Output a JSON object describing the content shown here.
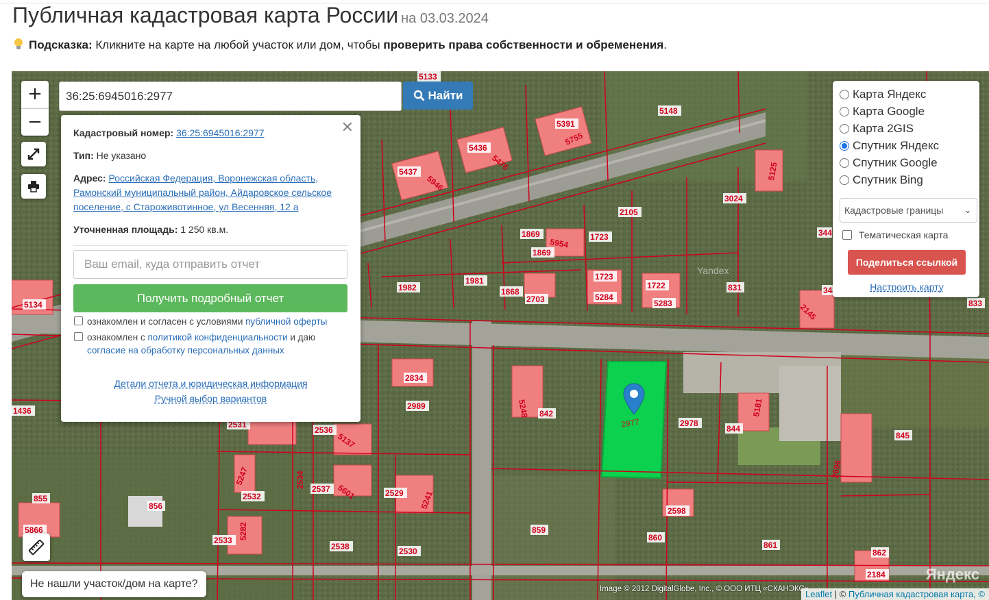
{
  "header": {
    "title": "Публичная кадастровая карта России",
    "date_suffix": "на 03.03.2024",
    "hint_label": "Подсказка:",
    "hint_text": " Кликните на карте на любой участок или дом, чтобы ",
    "hint_bold": "проверить права собственности и обременения",
    "hint_end": "."
  },
  "search": {
    "value": "36:25:6945016:2977",
    "button_label": "Найти"
  },
  "controls": {
    "zoom_in": "+",
    "zoom_out": "−"
  },
  "popup": {
    "cadastral_label": "Кадастровый номер:",
    "cadastral_value": "36:25:6945016:2977",
    "type_label": "Тип:",
    "type_value": "Не указано",
    "address_label": "Адрес:",
    "address_value": "Российская Федерация, Воронежская область, Рамонский муниципальный район, Айдаровское сельское поселение, с Староживотинное, ул Весенняя, 12 а",
    "area_label": "Уточненная площадь:",
    "area_value": "1 250 кв.м.",
    "email_placeholder": "Ваш email, куда отправить отчет",
    "report_button": "Получить подробный отчет",
    "agree1_text": "ознакомлен и согласен с условиями ",
    "agree1_link": "публичной оферты",
    "agree2_text": "ознакомлен с ",
    "agree2_link": "политикой конфиденциальности",
    "agree2_mid": " и даю ",
    "agree2_link2": "согласие на обработку персональных данных",
    "details_link": "Детали отчета и юридическая информация",
    "manual_link": "Ручной выбор вариантов"
  },
  "layers": {
    "options": [
      {
        "label": "Карта Яндекс",
        "checked": false
      },
      {
        "label": "Карта Google",
        "checked": false
      },
      {
        "label": "Карта 2GIS",
        "checked": false
      },
      {
        "label": "Спутник Яндекс",
        "checked": true
      },
      {
        "label": "Спутник Google",
        "checked": false
      },
      {
        "label": "Спутник Bing",
        "checked": false
      }
    ],
    "select_value": "Кадастровые границы",
    "thematic_label": "Тематическая карта",
    "share_button": "Поделиться ссылкой",
    "configure_link": "Настроить карту"
  },
  "map": {
    "not_found_button": "Не нашли участок/дом на карте?",
    "attribution_leaflet": "Leaflet",
    "attribution_sep": " | © ",
    "attribution_text": "Публичная кадастровая карта, ©",
    "imagery_credit": "Image © 2012 DigitalGlobe, Inc., © ООО ИТЦ «СКАНЭКС»",
    "watermark": "Яндекс",
    "selected_plot_label": "2977",
    "plot_labels": [
      "5133",
      "5148",
      "5391",
      "5755",
      "5436",
      "5476",
      "5437",
      "5946",
      "5125",
      "3024",
      "2105",
      "1869",
      "5954",
      "1723",
      "1869",
      "344",
      "1982",
      "1981",
      "1868",
      "2703",
      "1723",
      "5284",
      "1722",
      "5283",
      "831",
      "344",
      "2145",
      "833",
      "5134",
      "2834",
      "2989",
      "5248",
      "842",
      "2978",
      "844",
      "5181",
      "1436",
      "2531",
      "2536",
      "5137",
      "5247",
      "2532",
      "2537",
      "5601",
      "2529",
      "5241",
      "845",
      "2696",
      "855",
      "856",
      "5866",
      "5282",
      "2533",
      "2538",
      "2530",
      "2598",
      "859",
      "860",
      "861",
      "862",
      "2184"
    ],
    "colors": {
      "boundary": "#d1001c",
      "roof": "#f08080",
      "selected": "#00e050",
      "pin": "#2a81cb"
    }
  }
}
